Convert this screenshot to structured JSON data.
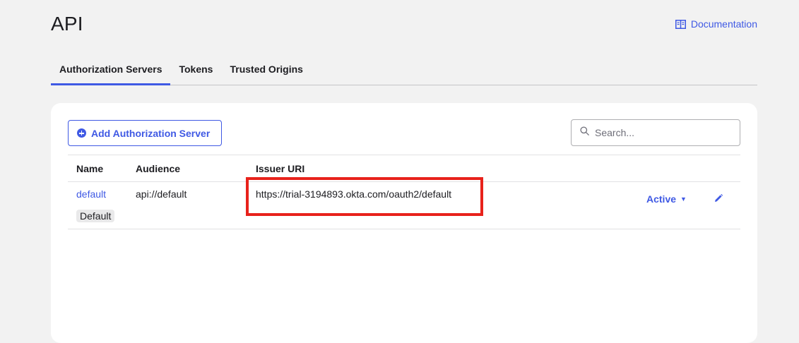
{
  "header": {
    "title": "API",
    "documentation_label": "Documentation"
  },
  "tabs": [
    {
      "label": "Authorization Servers",
      "active": true
    },
    {
      "label": "Tokens",
      "active": false
    },
    {
      "label": "Trusted Origins",
      "active": false
    }
  ],
  "toolbar": {
    "add_button_label": "Add Authorization Server",
    "search_placeholder": "Search..."
  },
  "table": {
    "columns": [
      "Name",
      "Audience",
      "Issuer URI"
    ],
    "rows": [
      {
        "name": "default",
        "badge": "Default",
        "audience": "api://default",
        "issuer_uri": "https://trial-3194893.okta.com/oauth2/default",
        "status": "Active"
      }
    ]
  },
  "colors": {
    "accent": "#3f59e4",
    "highlight": "#e8221b",
    "background": "#f2f2f2"
  },
  "icons": {
    "documentation": "book-icon",
    "add": "plus-circle-icon",
    "search": "search-icon",
    "status_dropdown": "caret-down-icon",
    "edit": "pencil-icon"
  }
}
